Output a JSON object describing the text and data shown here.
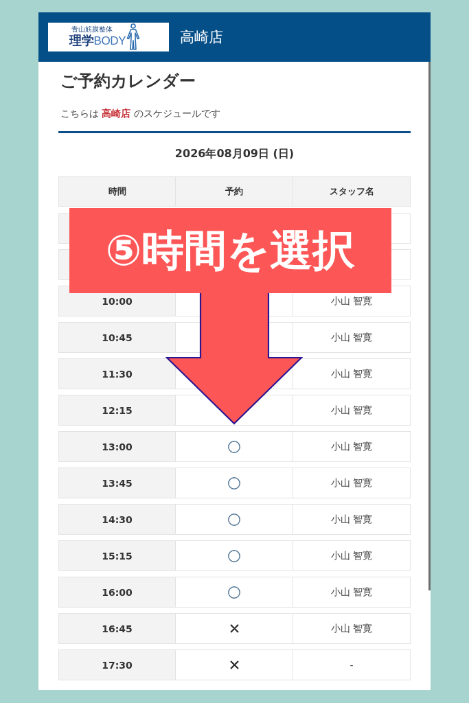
{
  "header": {
    "logo": {
      "tagline": "青山筋膜整体",
      "name": "**理学**BODY"
    },
    "store_name": "高崎店"
  },
  "page": {
    "title": "ご予約カレンダー",
    "subtitle": "こちらは **高崎店** のスケジュールです",
    "date": "2026年08月09日 (日)"
  },
  "table": {
    "columns": [
      "時間",
      "予約",
      "スタッフ名"
    ],
    "rows": [
      {},
      {},
      {
        "time": "10:00",
        "staff": "小山 智寛"
      },
      {
        "time": "10:45",
        "staff": "小山 智寛"
      },
      {
        "time": "11:30",
        "staff": "小山 智寛"
      },
      {
        "time": "12:15",
        "staff": "小山 智寛"
      },
      {
        "time": "13:00",
        "available": true,
        "staff": "小山 智寛"
      },
      {
        "time": "13:45",
        "available": true,
        "staff": "小山 智寛"
      },
      {
        "time": "14:30",
        "available": true,
        "staff": "小山 智寛"
      },
      {
        "time": "15:15",
        "available": true,
        "staff": "小山 智寛"
      },
      {
        "time": "16:00",
        "available": true,
        "staff": "小山 智寛"
      },
      {
        "time": "16:45",
        "available": false,
        "staff": "小山 智寛"
      },
      {
        "time": "17:30",
        "available": false,
        "staff": "-"
      }
    ]
  },
  "callout": {
    "text": "⑤時間を選択"
  }
}
